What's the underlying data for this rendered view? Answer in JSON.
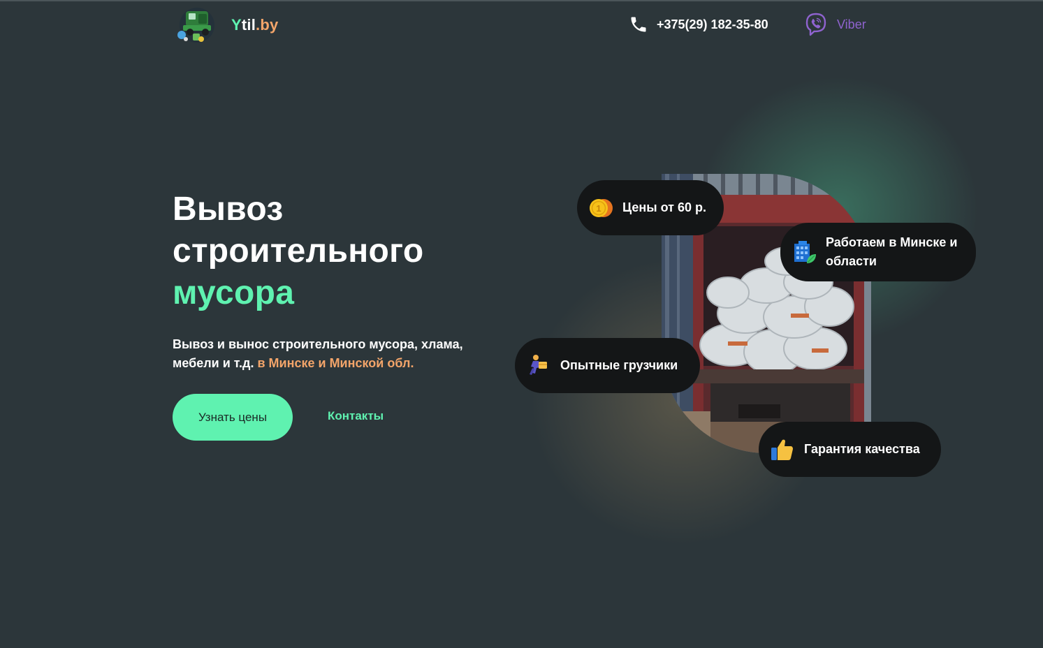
{
  "header": {
    "logo_text_a": "Y",
    "logo_text_b": "til",
    "logo_text_c": ".by",
    "phone": "+375(29) 182-35-80",
    "viber": "Viber"
  },
  "hero": {
    "title_line1": "Вывоз",
    "title_line2": "строительного",
    "title_line3": "мусора",
    "desc_main": "Вывоз и вынос строительного мусора, хлама, мебели и т.д.",
    "desc_highlight": "в Минске и Минской обл.",
    "btn_prices": "Узнать цены",
    "link_contacts": "Контакты"
  },
  "badges": {
    "price": "Цены от 60 р.",
    "region": "Работаем в Минске и области",
    "loaders": "Опытные грузчики",
    "quality": "Гарантия качества"
  },
  "coin_numeral": "1",
  "colors": {
    "background": "#2c363a",
    "accent_green": "#5ff2b0",
    "accent_orange": "#f3a56a",
    "viber_purple": "#8f63cf",
    "badge_bg": "#141617"
  },
  "icons": {
    "logo": "garbage-truck-logo-icon",
    "phone": "phone-icon",
    "viber": "viber-icon",
    "price": "coin-icon",
    "region": "building-icon",
    "loaders": "loader-person-icon",
    "quality": "thumbs-up-icon"
  }
}
